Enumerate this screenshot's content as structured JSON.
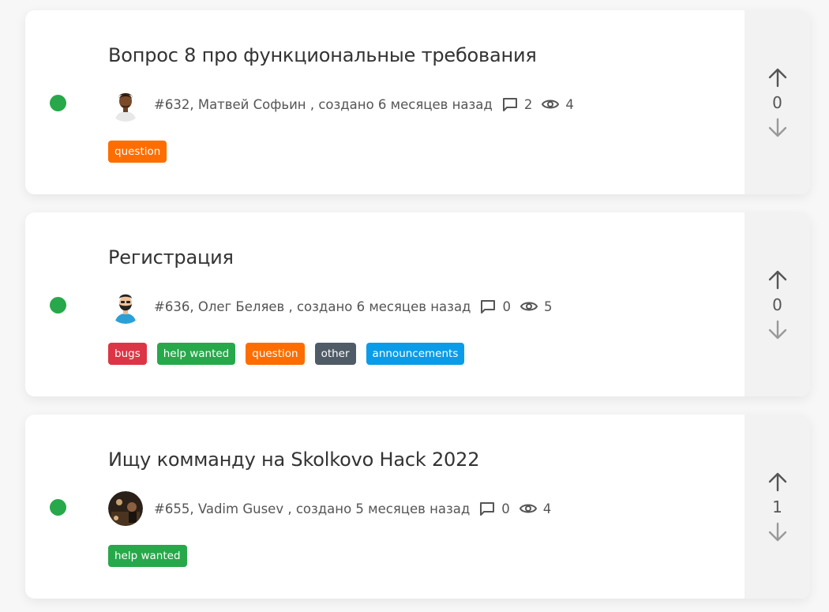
{
  "topics": [
    {
      "title": "Вопрос 8 про функциональные требования",
      "number": "#632,",
      "author": "Матвей Софьин",
      "created": ", создано 6 месяцев назад",
      "comments": "2",
      "views": "4",
      "votes": "0",
      "tags": [
        {
          "label": "question",
          "color": "#ff6d00"
        }
      ]
    },
    {
      "title": "Регистрация",
      "number": "#636,",
      "author": "Олег Беляев",
      "created": ", создано 6 месяцев назад",
      "comments": "0",
      "views": "5",
      "votes": "0",
      "tags": [
        {
          "label": "bugs",
          "color": "#dc3545"
        },
        {
          "label": "help wanted",
          "color": "#27a84a"
        },
        {
          "label": "question",
          "color": "#ff6d00"
        },
        {
          "label": "other",
          "color": "#4f5b66"
        },
        {
          "label": "announcements",
          "color": "#0a9ce8"
        }
      ]
    },
    {
      "title": "Ищу комманду на Skolkovo Hack 2022",
      "number": "#655,",
      "author": "Vadim Gusev",
      "created": ", создано 5 месяцев назад",
      "comments": "0",
      "views": "4",
      "votes": "1",
      "tags": [
        {
          "label": "help wanted",
          "color": "#27a84a"
        }
      ]
    }
  ],
  "icons": {
    "comment": "comment-icon",
    "views": "eye-icon",
    "upvote": "arrow-up-icon",
    "downvote": "arrow-down-icon"
  },
  "colors": {
    "status_open": "#27a84a",
    "vote_panel": "#f2f2f2"
  }
}
